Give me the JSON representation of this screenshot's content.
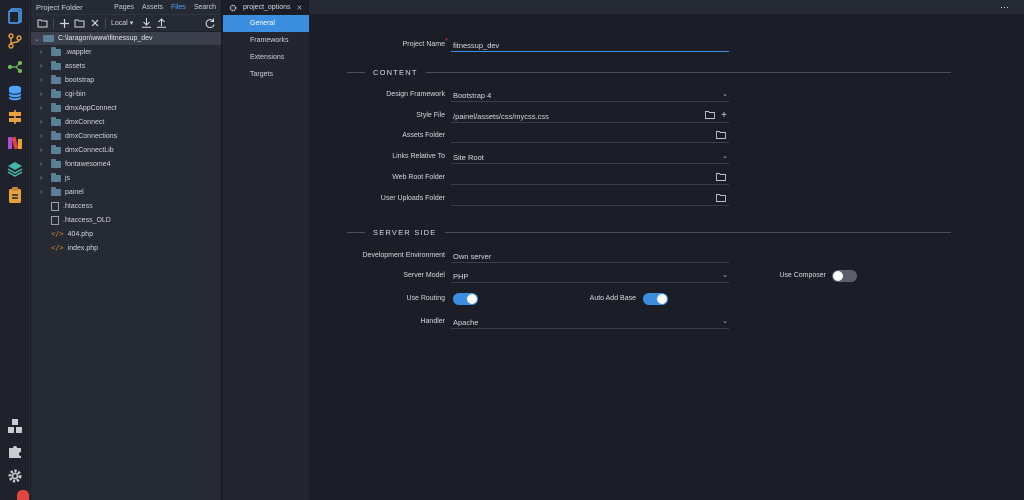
{
  "panel": {
    "title": "Project Folder",
    "tabs": [
      "Pages",
      "Assets",
      "Files",
      "Search"
    ],
    "active_tab": "Files",
    "toolbar": {
      "local_label": "Local"
    }
  },
  "tree": {
    "root": "C:\\laragon\\www\\fitnessup_dev",
    "folders": [
      ".wappler",
      "assets",
      "bootstrap",
      "cgi-bin",
      "dmxAppConnect",
      "dmxConnect",
      "dmxConnections",
      "dmxConnectLib",
      "fontawesome4",
      "js",
      "painel"
    ],
    "files": [
      ".htaccess",
      ".htaccess_OLD"
    ],
    "code_files": [
      "404.php",
      "index.php"
    ]
  },
  "editor": {
    "tab_label": "project_options",
    "subnav": [
      "General",
      "Frameworks",
      "Extensions",
      "Targets"
    ],
    "active_subnav": "General"
  },
  "form": {
    "project_name_label": "Project Name",
    "project_name_value": "fitnessup_dev",
    "content_section": "CONTENT",
    "design_framework_label": "Design Framework",
    "design_framework_value": "Bootstrap 4",
    "style_file_label": "Style File",
    "style_file_value": "/painel/assets/css/mycss.css",
    "assets_folder_label": "Assets Folder",
    "assets_folder_value": "",
    "links_relative_label": "Links Relative To",
    "links_relative_value": "Site Root",
    "web_root_label": "Web Root Folder",
    "web_root_value": "",
    "user_uploads_label": "User Uploads Folder",
    "user_uploads_value": "",
    "server_section": "SERVER SIDE",
    "dev_env_label": "Development Environment",
    "dev_env_value": "Own server",
    "server_model_label": "Server Model",
    "server_model_value": "PHP",
    "use_composer_label": "Use Composer",
    "use_composer_on": false,
    "use_routing_label": "Use Routing",
    "use_routing_on": true,
    "auto_add_base_label": "Auto Add Base",
    "auto_add_base_on": true,
    "handler_label": "Handler",
    "handler_value": "Apache"
  },
  "colors": {
    "accent": "#3b8ee0",
    "background": "#1b1e26",
    "panel": "#262a33",
    "folder": "#5d7f96"
  }
}
